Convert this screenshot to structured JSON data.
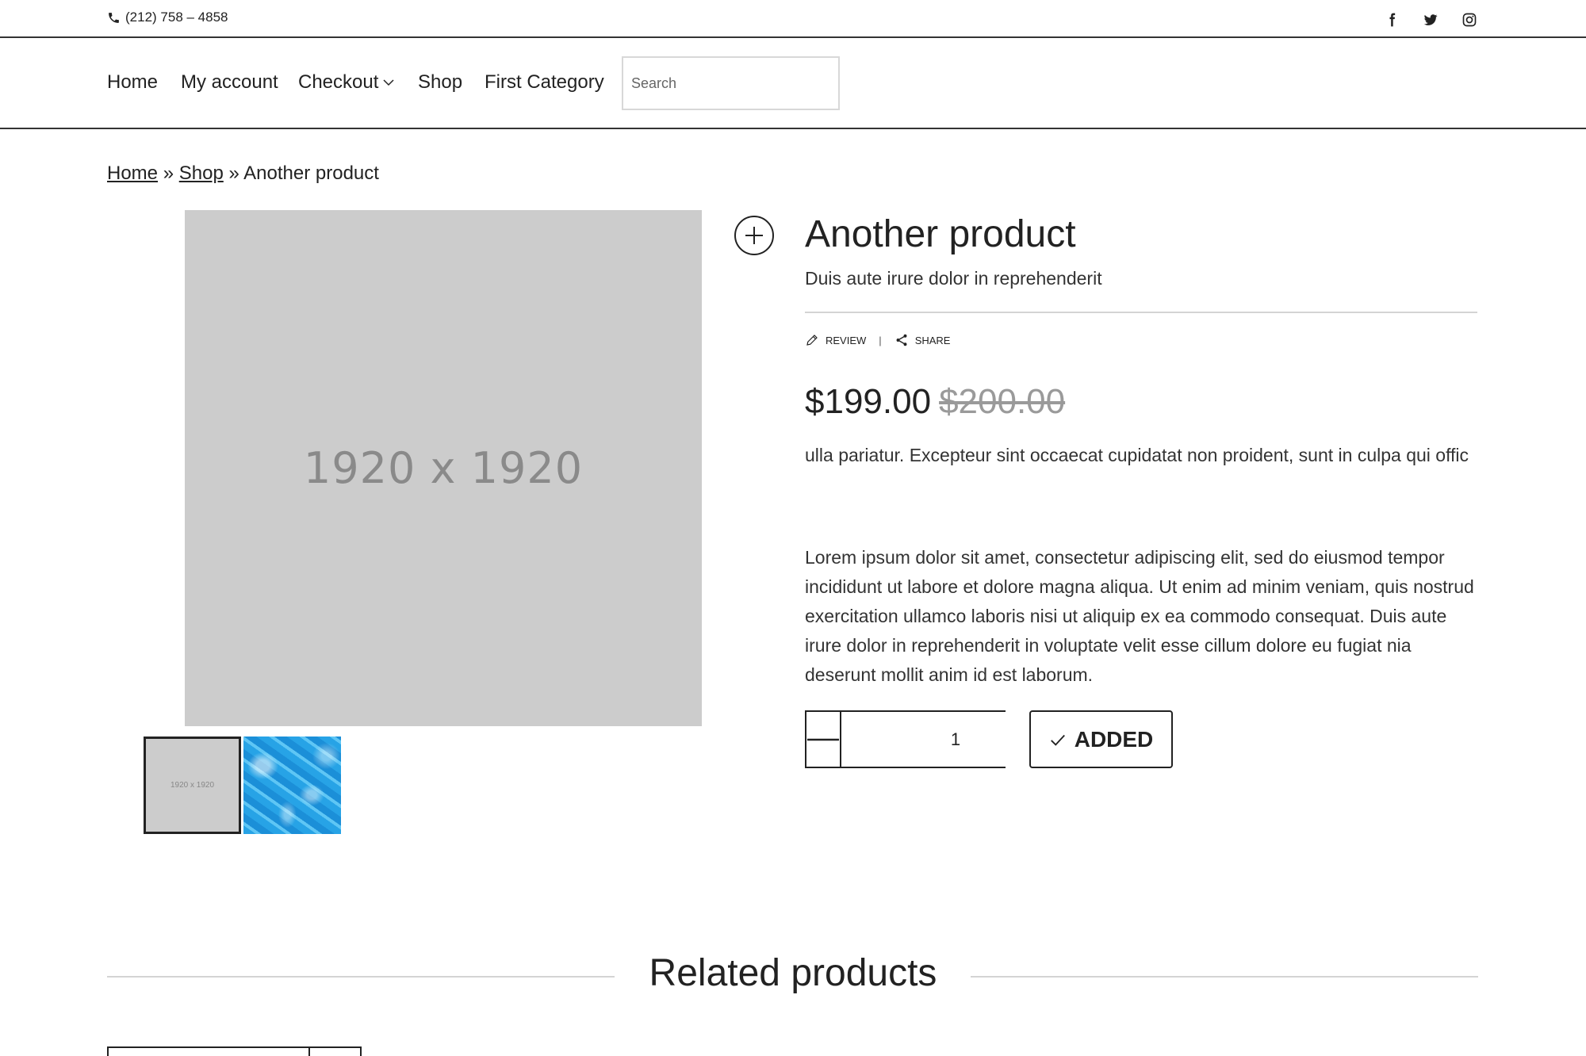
{
  "topbar": {
    "phone": "(212) 758 – 4858",
    "social": [
      "facebook-icon",
      "twitter-icon",
      "instagram-icon"
    ]
  },
  "nav": {
    "items": [
      {
        "label": "Home"
      },
      {
        "label": "My account"
      },
      {
        "label": "Checkout"
      },
      {
        "label": "Shop"
      },
      {
        "label": "First Category"
      }
    ],
    "search_placeholder": "Search"
  },
  "breadcrumb": {
    "home": "Home",
    "sep": "»",
    "shop": "Shop",
    "current": "Another product"
  },
  "gallery": {
    "main_placeholder": "1920 x 1920",
    "thumb_placeholder": "1920 x 1920"
  },
  "product": {
    "title": "Another product",
    "subtitle": "Duis aute irure dolor in reprehenderit",
    "review_label": "REVIEW",
    "separator": "|",
    "share_label": "SHARE",
    "price": "$199.00",
    "old_price": "$200.00",
    "short_description": "ulla pariatur. Excepteur sint occaecat cupidatat non proident, sunt in culpa qui offic",
    "description": "Lorem ipsum dolor sit amet, consectetur adipiscing elit, sed do eiusmod tempor incididunt ut labore et dolore magna aliqua. Ut enim ad minim veniam, quis nostrud exercitation ullamco laboris nisi ut aliquip ex ea commodo consequat. Duis aute irure dolor in reprehenderit in voluptate velit esse cillum dolore eu fugiat nia deserunt mollit anim id est laborum.",
    "quantity": "1",
    "added_label": "ADDED"
  },
  "related": {
    "title": "Related products"
  },
  "colors": {
    "text": "#222222",
    "placeholder_bg": "#cccccc",
    "old_price": "#9a9a9a",
    "divider": "#d4d4d4"
  }
}
